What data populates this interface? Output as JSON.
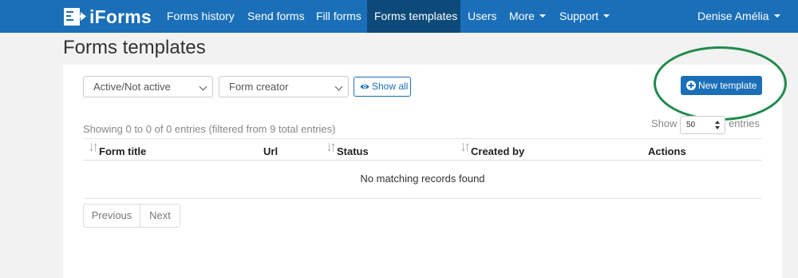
{
  "brand": {
    "name": "iForms",
    "icon": "forms-logo-icon"
  },
  "nav": {
    "items": [
      {
        "label": "Forms history"
      },
      {
        "label": "Send forms"
      },
      {
        "label": "Fill forms"
      },
      {
        "label": "Forms templates",
        "active": true
      },
      {
        "label": "Users"
      },
      {
        "label": "More"
      },
      {
        "label": "Support"
      }
    ],
    "user": "Denise Amélia"
  },
  "page": {
    "title": "Forms templates"
  },
  "filters": {
    "status": "Active/Not active",
    "creator": "Form creator",
    "show_all": "Show all"
  },
  "actions": {
    "new_template": "New template"
  },
  "table": {
    "info": "Showing 0 to 0 of 0 entries (filtered from 9 total entries)",
    "length": {
      "show": "Show",
      "value": "50",
      "entries": "entries"
    },
    "columns": [
      "Form title",
      "Url",
      "Status",
      "Created by",
      "Actions"
    ],
    "empty": "No matching records found"
  },
  "pagination": {
    "previous": "Previous",
    "next": "Next"
  },
  "colors": {
    "navbar": "#1a6fb8",
    "nav_active": "#0c4a7a",
    "primary": "#1a6fb8",
    "highlight_ellipse": "#1f8a4c"
  }
}
